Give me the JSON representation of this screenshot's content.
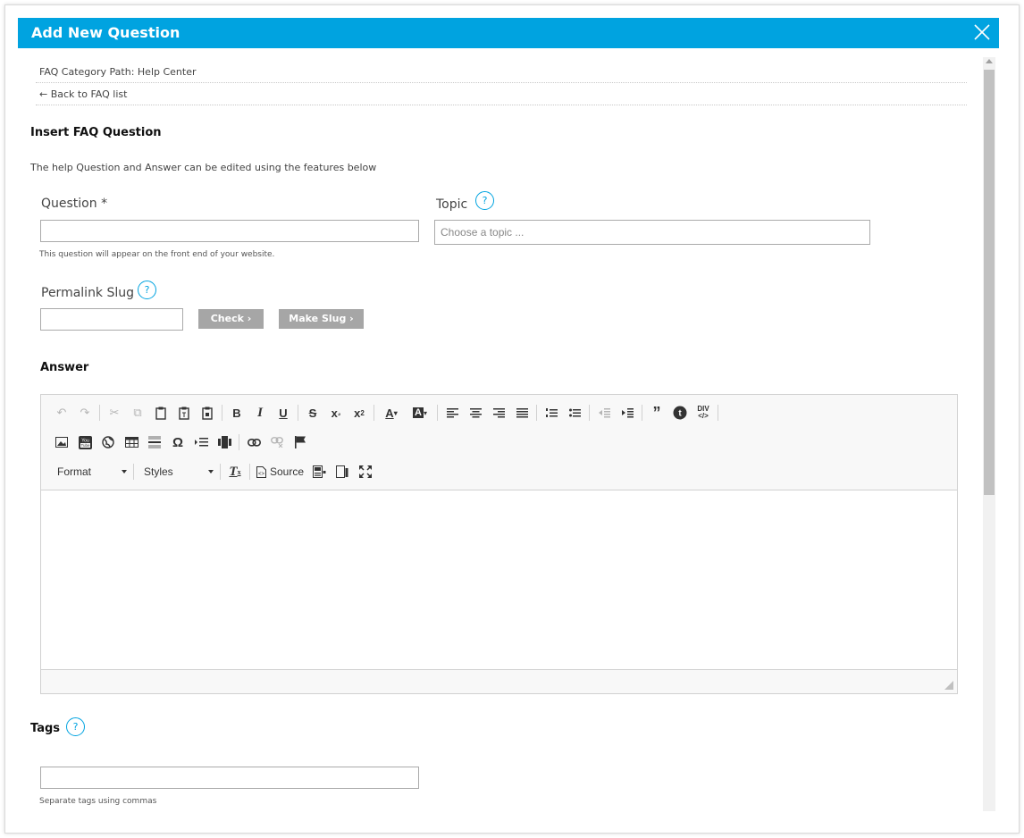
{
  "modal": {
    "title": "Add New Question"
  },
  "breadcrumb": {
    "category_path": "FAQ Category Path:  Help Center",
    "back_link": "← Back to FAQ list"
  },
  "section": {
    "heading": "Insert FAQ Question",
    "description": "The help Question and Answer can be edited using the features below"
  },
  "question": {
    "label": "Question *",
    "value": "",
    "hint": "This question will appear on the front end of your website."
  },
  "topic": {
    "label": "Topic",
    "placeholder": "Choose a topic ..."
  },
  "permalink": {
    "label": "Permalink Slug",
    "value": "",
    "check_label": "Check  ›",
    "make_slug_label": "Make Slug  ›"
  },
  "answer": {
    "label": "Answer",
    "editor": {
      "format_label": "Format",
      "styles_label": "Styles",
      "source_label": "Source",
      "content": ""
    }
  },
  "tags": {
    "label": "Tags",
    "value": "",
    "hint": "Separate tags using commas"
  },
  "help_icon_text": "?",
  "colors": {
    "accent": "#00a3e0",
    "button_gray": "#a6a6a6"
  }
}
